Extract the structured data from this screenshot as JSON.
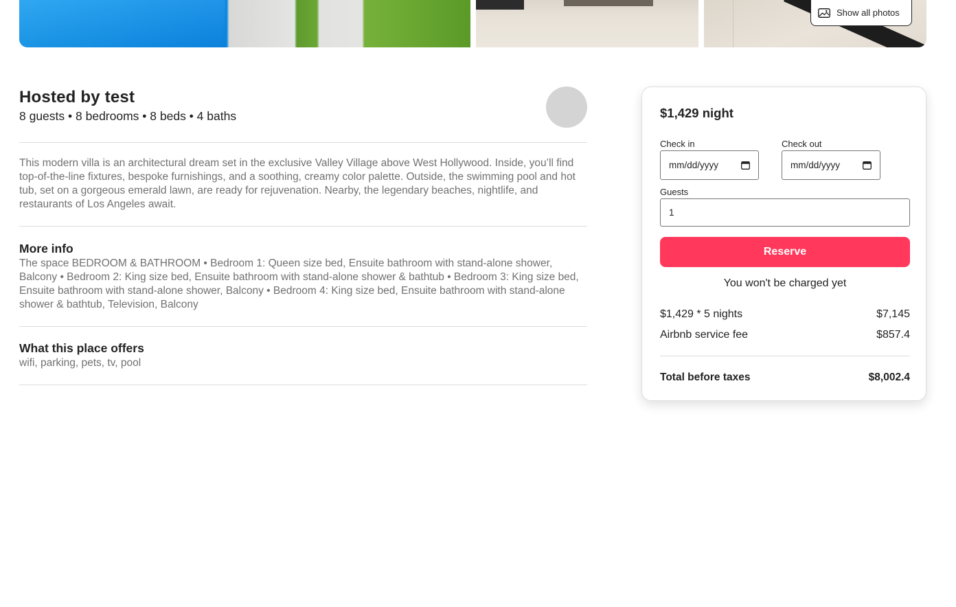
{
  "photos": {
    "show_all_label": "Show all photos",
    "icon": "image-icon"
  },
  "listing": {
    "host_title": "Hosted by test",
    "meta": "8 guests • 8 bedrooms • 8 beds • 4 baths",
    "description": "This modern villa is an architectural dream set in the exclusive Valley Village above West Hollywood. Inside, you’ll find top-of-the-line fixtures, bespoke furnishings, and a soothing, creamy color palette. Outside, the swimming pool and hot tub, set on a gorgeous emerald lawn, are ready for rejuvenation. Nearby, the legendary beaches, nightlife, and restaurants of Los Angeles await.",
    "more_info_title": "More info",
    "more_info_text": "The space BEDROOM & BATHROOM • Bedroom 1: Queen size bed, Ensuite bathroom with stand-alone shower, Balcony • Bedroom 2: King size bed, Ensuite bathroom with stand-alone shower & bathtub • Bedroom 3: King size bed, Ensuite bathroom with stand-alone shower, Balcony • Bedroom 4: King size bed, Ensuite bathroom with stand-alone shower & bathtub, Television, Balcony",
    "offers_title": "What this place offers",
    "offers_text": "wifi, parking, pets, tv, pool"
  },
  "booking": {
    "price_label": "$1,429 night",
    "check_in_label": "Check in",
    "check_in_value": "mm/dd/yyyy",
    "check_out_label": "Check out",
    "check_out_value": "mm/dd/yyyy",
    "guests_label": "Guests",
    "guests_value": "1",
    "reserve_label": "Reserve",
    "no_charge_note": "You won't be charged yet",
    "nights_line_label": "$1,429 * 5 nights",
    "nights_line_value": "$7,145",
    "fee_label": "Airbnb service fee",
    "fee_value": "$857.4",
    "total_label": "Total before taxes",
    "total_value": "$8,002.4",
    "accent_color": "#ff385c"
  }
}
